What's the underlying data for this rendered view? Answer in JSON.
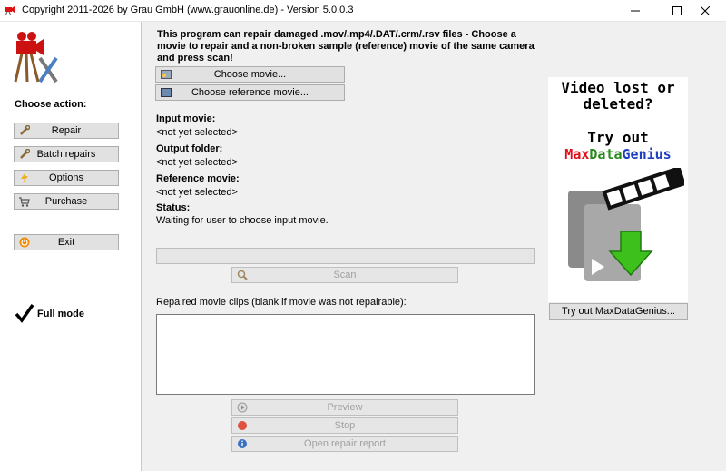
{
  "window": {
    "title": "Copyright 2011-2026 by Grau GmbH (www.grauonline.de) - Version 5.0.0.3",
    "minimize_icon": "minimize-icon",
    "maximize_icon": "maximize-icon",
    "close_icon": "close-icon"
  },
  "sidebar": {
    "choose_action_label": "Choose action:",
    "buttons": {
      "repair": "Repair",
      "batch_repairs": "Batch repairs",
      "options": "Options",
      "purchase": "Purchase",
      "exit": "Exit"
    },
    "full_mode_label": "Full mode"
  },
  "main": {
    "intro_text": "This program can repair damaged .mov/.mp4/.DAT/.crm/.rsv files - Choose a movie to repair and a non-broken sample (reference) movie of the same camera and press scan!",
    "choose_movie_button": "Choose movie...",
    "choose_reference_button": "Choose reference movie...",
    "input_movie_label": "Input movie:",
    "input_movie_value": "<not yet selected>",
    "output_folder_label": "Output folder:",
    "output_folder_value": "<not yet selected>",
    "reference_movie_label": "Reference movie:",
    "reference_movie_value": "<not yet selected>",
    "status_label": "Status:",
    "status_value": "Waiting for user to choose input movie.",
    "progress": 0,
    "scan_button": "Scan",
    "repaired_clips_label": "Repaired movie clips (blank if movie was not repairable):",
    "preview_button": "Preview",
    "stop_button": "Stop",
    "open_report_button": "Open repair report"
  },
  "ad": {
    "line1": "Video lost or",
    "line2": "deleted?",
    "line3": "Try out",
    "brand_part1": "MaxData",
    "brand_part2": "Genius",
    "button": "Try out MaxDataGenius...",
    "colors": {
      "max": "#e0101a",
      "data": "#2a8a1e",
      "genius": "#1e3fbf"
    }
  }
}
